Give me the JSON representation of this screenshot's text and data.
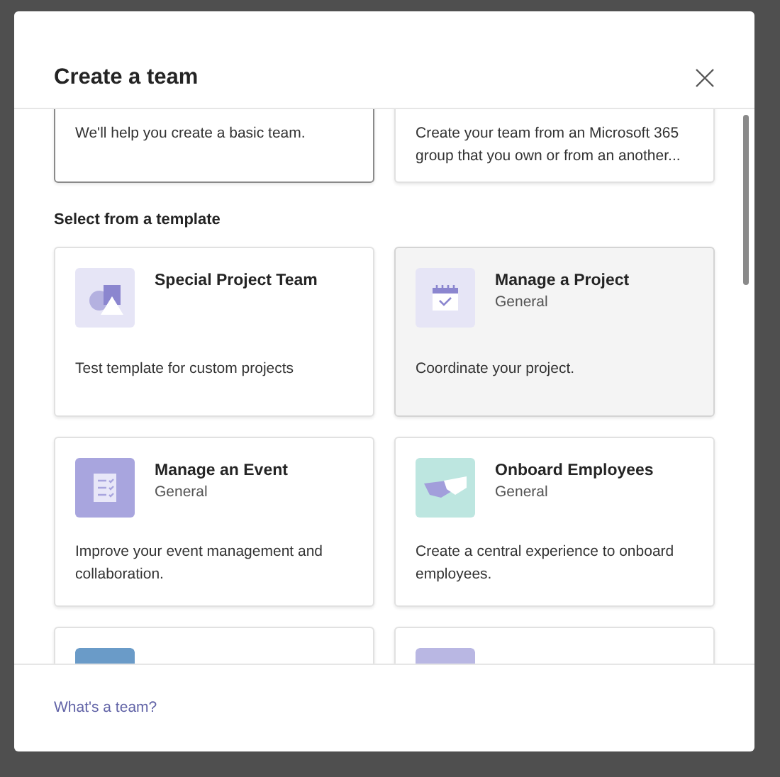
{
  "dialog": {
    "title": "Create a team"
  },
  "top_cards": [
    {
      "description": "We'll help you create a basic team.",
      "focused": true
    },
    {
      "description": "Create your team from an Microsoft 365 group that you own or from an another...",
      "focused": false
    }
  ],
  "section_title": "Select from a template",
  "templates": [
    {
      "kind": "shapes",
      "title": "Special Project Team",
      "description": "Test template for custom projects",
      "highlighted": false
    },
    {
      "kind": "calendar",
      "title": "Manage a Project",
      "subtitle": "General",
      "description": "Coordinate your project.",
      "highlighted": true
    },
    {
      "kind": "checklist",
      "title": "Manage an Event",
      "subtitle": "General",
      "description": "Improve your event management and collaboration.",
      "highlighted": false
    },
    {
      "kind": "handshake",
      "title": "Onboard Employees",
      "subtitle": "General",
      "description": "Create a central experience to onboard employees.",
      "highlighted": false
    }
  ],
  "partial_cards": [
    {
      "color": "#6a9bc8"
    },
    {
      "color": "#b9b7e3"
    }
  ],
  "footer_link": "What's a team?"
}
